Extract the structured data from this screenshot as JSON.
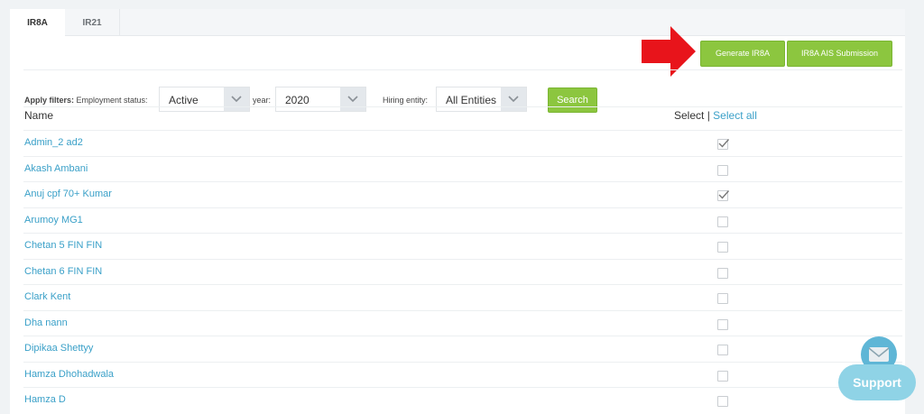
{
  "tabs": [
    {
      "label": "IR8A",
      "active": true
    },
    {
      "label": "IR21",
      "active": false
    }
  ],
  "actions": {
    "generate_label": "Generate IR8A",
    "ais_label": "IR8A AIS Submission"
  },
  "filters": {
    "apply_label": "Apply filters:",
    "employment_label": "Employment status:",
    "employment_value": "Active",
    "year_label": "year:",
    "year_value": "2020",
    "hiring_label": "Hiring entity:",
    "hiring_value": "All Entities",
    "search_label": "Search"
  },
  "table": {
    "name_header": "Name",
    "select_header": "Select",
    "select_divider": "|",
    "select_all": "Select all",
    "rows": [
      {
        "name": "Admin_2 ad2",
        "checked": true
      },
      {
        "name": "Akash Ambani",
        "checked": false
      },
      {
        "name": "Anuj cpf 70+ Kumar",
        "checked": true
      },
      {
        "name": "Arumoy MG1",
        "checked": false
      },
      {
        "name": "Chetan 5 FIN FIN",
        "checked": false
      },
      {
        "name": "Chetan 6 FIN FIN",
        "checked": false
      },
      {
        "name": "Clark Kent",
        "checked": false
      },
      {
        "name": "Dha nann",
        "checked": false
      },
      {
        "name": "Dipikaa Shettyy",
        "checked": false
      },
      {
        "name": "Hamza Dhohadwala",
        "checked": false
      },
      {
        "name": "Hamza D",
        "checked": false
      }
    ]
  },
  "support": {
    "label": "Support",
    "icon": "envelope-icon"
  },
  "colors": {
    "accent": "#8cc63f",
    "link": "#3aa0c8",
    "arrow": "#e8141b"
  }
}
